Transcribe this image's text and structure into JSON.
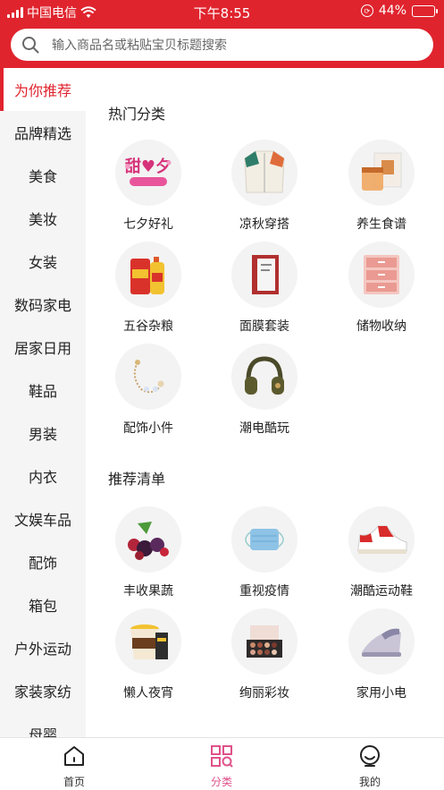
{
  "status_bar": {
    "carrier": "中国电信",
    "time": "下午8:55",
    "battery": "44%"
  },
  "search": {
    "placeholder": "输入商品名或粘贴宝贝标题搜索"
  },
  "sidebar": {
    "items": [
      {
        "label": "为你推荐",
        "active": true
      },
      {
        "label": "品牌精选"
      },
      {
        "label": "美食"
      },
      {
        "label": "美妆"
      },
      {
        "label": "女装"
      },
      {
        "label": "数码家电"
      },
      {
        "label": "居家日用"
      },
      {
        "label": "鞋品"
      },
      {
        "label": "男装"
      },
      {
        "label": "内衣"
      },
      {
        "label": "文娱车品"
      },
      {
        "label": "配饰"
      },
      {
        "label": "箱包"
      },
      {
        "label": "户外运动"
      },
      {
        "label": "家装家纺"
      },
      {
        "label": "母婴"
      }
    ]
  },
  "hot_section": {
    "title": "热门分类",
    "items": [
      {
        "label": "七夕好礼",
        "icon": "qixi-gift-icon"
      },
      {
        "label": "凉秋穿搭",
        "icon": "jacket-icon"
      },
      {
        "label": "养生食谱",
        "icon": "tea-icon"
      },
      {
        "label": "五谷杂粮",
        "icon": "grain-oil-icon"
      },
      {
        "label": "面膜套装",
        "icon": "facemask-box-icon"
      },
      {
        "label": "储物收纳",
        "icon": "storage-drawer-icon"
      },
      {
        "label": "配饰小件",
        "icon": "bracelet-icon"
      },
      {
        "label": "潮电酷玩",
        "icon": "headphones-icon"
      }
    ]
  },
  "recommend_section": {
    "title": "推荐清单",
    "items": [
      {
        "label": "丰收果蔬",
        "icon": "fruit-icon"
      },
      {
        "label": "重视疫情",
        "icon": "face-mask-icon"
      },
      {
        "label": "潮酷运动鞋",
        "icon": "sneaker-icon"
      },
      {
        "label": "懒人夜宵",
        "icon": "instant-noodle-icon"
      },
      {
        "label": "绚丽彩妆",
        "icon": "eyeshadow-palette-icon"
      },
      {
        "label": "家用小电",
        "icon": "iron-icon"
      }
    ]
  },
  "tabbar": {
    "tabs": [
      {
        "label": "首页",
        "icon": "home-icon"
      },
      {
        "label": "分类",
        "icon": "category-icon",
        "active": true
      },
      {
        "label": "我的",
        "icon": "profile-icon"
      }
    ]
  },
  "colors": {
    "brand_red": "#e0242e",
    "tab_active": "#e0528a",
    "sidebar_bg": "#f5f5f5"
  }
}
